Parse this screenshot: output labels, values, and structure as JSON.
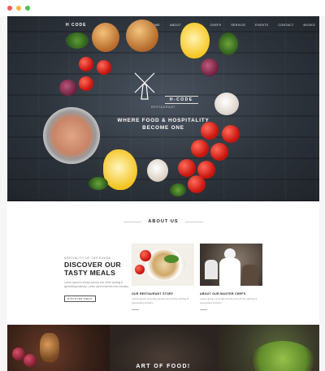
{
  "window": {
    "dot_colors": [
      "#ee5b5b",
      "#f2b843",
      "#4fbf59"
    ]
  },
  "nav": {
    "logo_text": "H CODE",
    "items": [
      "HOME",
      "ABOUT",
      "MENU",
      "CHEFS",
      "SERVICE",
      "EVENTS",
      "CONTACT",
      "BOOKS"
    ]
  },
  "hero": {
    "brand": "H-CODE",
    "brand_sub": "RESTAURANT",
    "tagline_line1": "WHERE FOOD & HOSPITALITY",
    "tagline_line2": "BECOME ONE"
  },
  "about": {
    "section_title": "ABOUT US",
    "kicker": "SPECIALITY OF THE HOUSE",
    "headline_line1": "DISCOVER OUR",
    "headline_line2": "TASTY MEALS",
    "body": "Lorem Ipsum is simply dummy text of the printing & typesetting industry. Lorem Ipsum has been the industry.",
    "button_label": "DISCOVER MENU",
    "cards": [
      {
        "label": "OUR RESTAURANT STORY",
        "text": "Lorem Ipsum is simply dummy text of the printing & typesetting industry."
      },
      {
        "label": "ABOUT OUR MASTER CHEFS",
        "text": "Lorem Ipsum is simply dummy text of the printing & typesetting industry."
      }
    ]
  },
  "band": {
    "title": "ART OF FOOD!"
  },
  "colors": {
    "hero_dark": "#2e343c",
    "tomato": "#d8231a",
    "text_dark": "#1e1e1e",
    "text_muted": "#8a8a8a"
  }
}
